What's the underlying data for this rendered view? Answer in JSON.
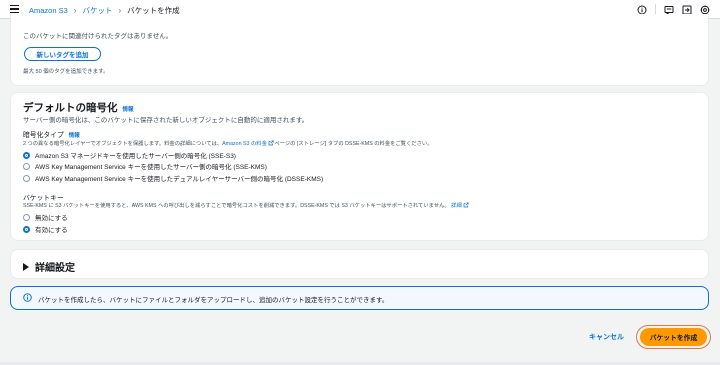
{
  "breadcrumb": {
    "service": "Amazon S3",
    "buckets": "バケット",
    "current": "バケットを作成"
  },
  "tags": {
    "empty_text": "このバケットに関連付けられたタグはありません。",
    "add_button": "新しいタグを追加",
    "limit_text": "最大 50 個のタグを追加できます。"
  },
  "encryption": {
    "title": "デフォルトの暗号化",
    "info": "情報",
    "description": "サーバー側の暗号化は、このバケットに保存された新しいオブジェクトに自動的に適用されます。",
    "type_label": "暗号化タイプ",
    "type_info": "情報",
    "type_desc_before": "2 つの異なる暗号化レイヤーでオブジェクトを保護します。料金の詳細については、",
    "type_desc_link": "Amazon S3 の料金",
    "type_desc_after": "ページの [ストレージ] タブの DSSE-KMS の料金をご覧ください。",
    "options": [
      {
        "label": "Amazon S3 マネージドキーを使用したサーバー側の暗号化 (SSE-S3)",
        "selected": true
      },
      {
        "label": "AWS Key Management Service キーを使用したサーバー側の暗号化 (SSE-KMS)",
        "selected": false
      },
      {
        "label": "AWS Key Management Service キーを使用したデュアルレイヤーサーバー側の暗号化 (DSSE-KMS)",
        "selected": false
      }
    ],
    "bucket_key_label": "バケットキー",
    "bucket_key_desc": "SSE-KMS に S3 バケットキーを使用すると、AWS KMS への呼び出しを減らすことで暗号化コストを削減できます。DSSE-KMS では S3 バケットキーはサポートされていません。",
    "bucket_key_link": "詳細",
    "bucket_key_options": [
      {
        "label": "無効にする",
        "selected": false
      },
      {
        "label": "有効にする",
        "selected": true
      }
    ]
  },
  "advanced": {
    "title": "詳細設定"
  },
  "alert": {
    "text": "バケットを作成したら、バケットにファイルとフォルダをアップロードし、追加のバケット設定を行うことができます。"
  },
  "actions": {
    "cancel": "キャンセル",
    "create": "バケットを作成"
  },
  "colors": {
    "link": "#0972d3",
    "primary_button": "#ff9900",
    "focus_ring": "#e07941",
    "alert_bg": "#f2f8fd"
  }
}
